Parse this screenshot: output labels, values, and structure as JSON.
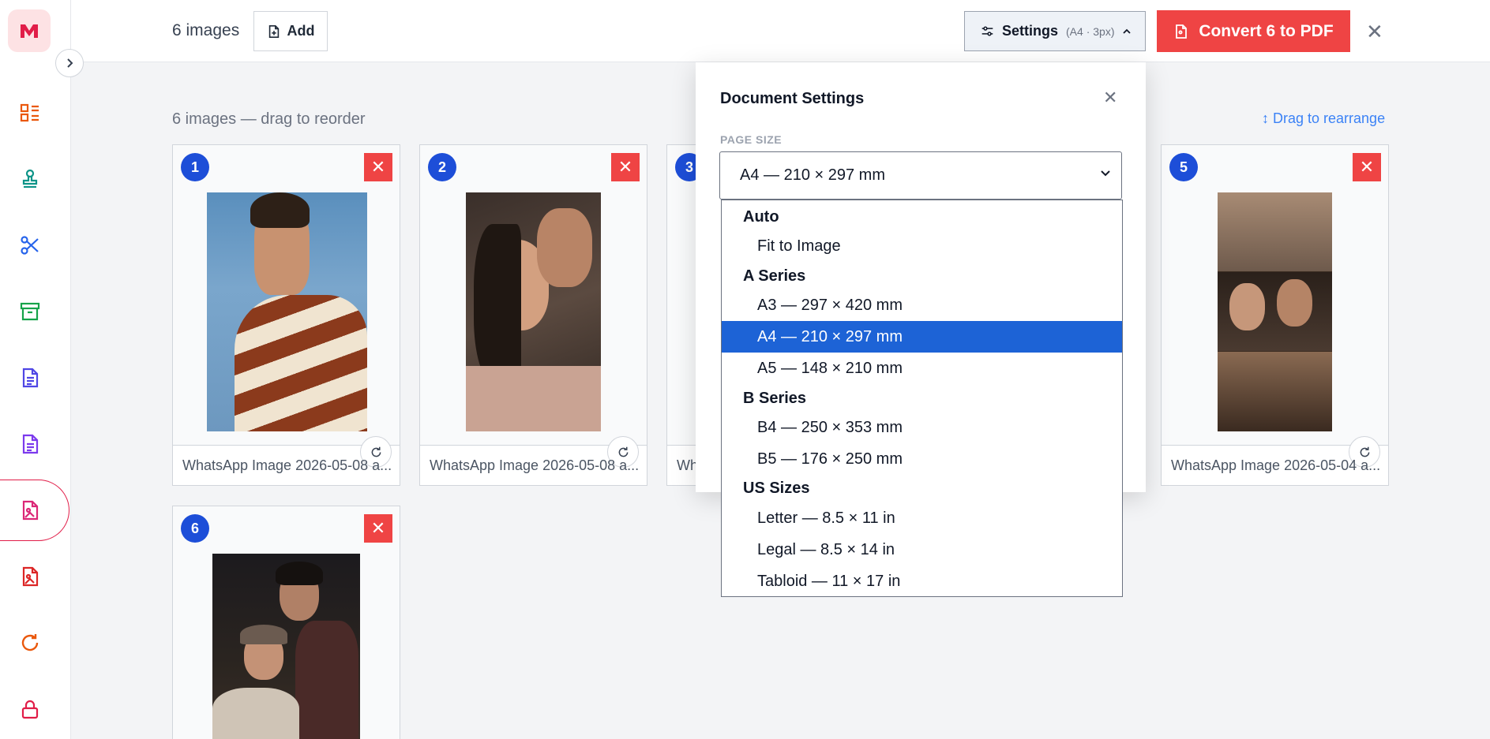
{
  "topbar": {
    "image_count": "6 images",
    "add_label": "Add",
    "settings_label": "Settings",
    "settings_sub": "(A4 · 3px)",
    "convert_label": "Convert 6 to PDF"
  },
  "main": {
    "subtitle": "6 images — drag to reorder",
    "drag_hint": "↕ Drag to rearrange"
  },
  "cards": [
    {
      "number": "1",
      "filename": "WhatsApp Image 2026-05-08 a..."
    },
    {
      "number": "2",
      "filename": "WhatsApp Image 2026-05-08 a..."
    },
    {
      "number": "3",
      "filename": "Wh"
    },
    {
      "number": "5",
      "filename": "WhatsApp Image 2026-05-04 a..."
    },
    {
      "number": "6",
      "filename": ""
    }
  ],
  "settings_panel": {
    "title": "Document Settings",
    "page_size_label": "PAGE SIZE",
    "selected": "A4 — 210 × 297 mm"
  },
  "dropdown": {
    "groups": [
      {
        "label": "Auto",
        "options": [
          "Fit to Image"
        ]
      },
      {
        "label": "A Series",
        "options": [
          "A3 — 297 × 420 mm",
          "A4 — 210 × 297 mm",
          "A5 — 148 × 210 mm"
        ]
      },
      {
        "label": "B Series",
        "options": [
          "B4 — 250 × 353 mm",
          "B5 — 176 × 250 mm"
        ]
      },
      {
        "label": "US Sizes",
        "options": [
          "Letter — 8.5 × 11 in",
          "Legal — 8.5 × 14 in",
          "Tabloid — 11 × 17 in"
        ]
      }
    ]
  },
  "colors": {
    "accent_red": "#ef4444",
    "badge_blue": "#1d4ed8",
    "selected_blue": "#1d63d6",
    "link_blue": "#3b82f6"
  }
}
